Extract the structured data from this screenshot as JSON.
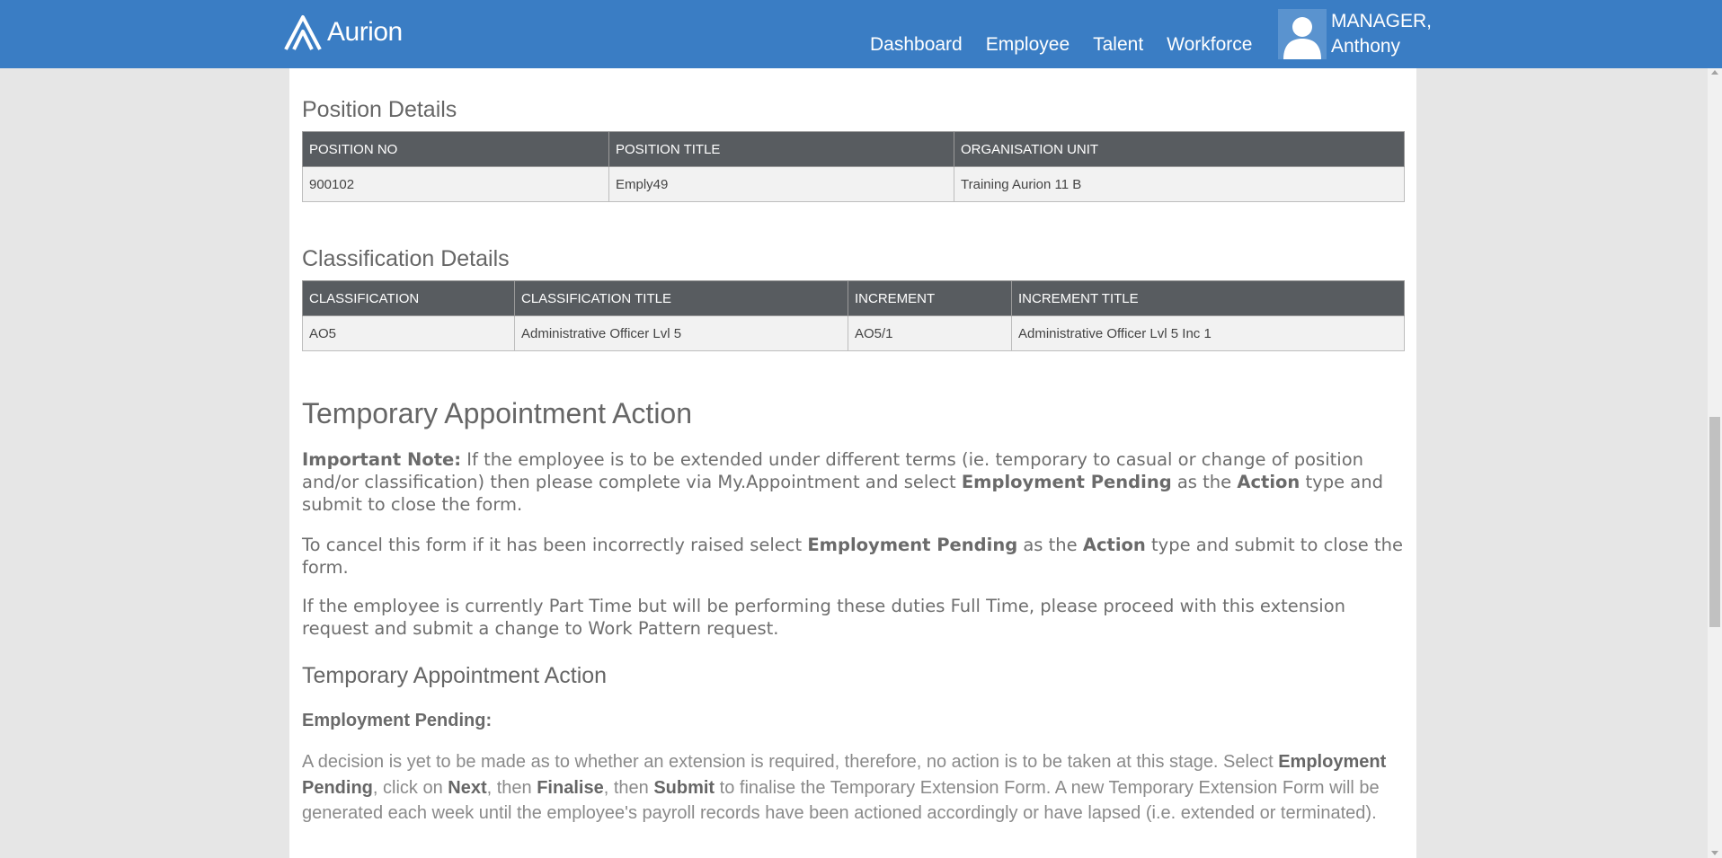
{
  "header": {
    "logo_text": "Aurion",
    "nav": [
      "Dashboard",
      "Employee",
      "Talent",
      "Workforce"
    ],
    "user_line1": "MANAGER,",
    "user_line2": "Anthony"
  },
  "position": {
    "title": "Position Details",
    "columns": [
      "POSITION NO",
      "POSITION TITLE",
      "ORGANISATION UNIT"
    ],
    "row": [
      "900102",
      "Emply49",
      "Training Aurion 11 B"
    ]
  },
  "classification": {
    "title": "Classification Details",
    "columns": [
      "CLASSIFICATION",
      "CLASSIFICATION TITLE",
      "INCREMENT",
      "INCREMENT TITLE"
    ],
    "row": [
      "AO5",
      "Administrative Officer Lvl 5",
      "AO5/1",
      "Administrative Officer Lvl 5 Inc 1"
    ]
  },
  "action": {
    "heading": "Temporary Appointment Action",
    "note1_label": "Important Note:",
    "note1_a": " If the employee is to be extended under different terms (ie. temporary to casual or change of position and/or classification) then please complete via My.Appointment and select ",
    "note1_b": "Employment Pending",
    "note1_c": " as the ",
    "note1_d": "Action",
    "note1_e": " type and submit to close the form.",
    "note2_a": "To cancel this form if it has been incorrectly raised select ",
    "note2_b": "Employment Pending",
    "note2_c": " as the ",
    "note2_d": "Action",
    "note2_e": " type and submit to close the form.",
    "note3": "If the employee is currently Part Time but will be performing these duties Full Time, please proceed with this extension request and submit a change to Work Pattern request.",
    "subheading": "Temporary Appointment Action",
    "pending_label": "Employment Pending:",
    "pending_a": "A decision is yet to be made as to whether an extension is required, therefore, no action is to be taken at this stage. Select ",
    "pending_b": "Employment Pending",
    "pending_c": ", click on ",
    "pending_d": "Next",
    "pending_e": ", then ",
    "pending_f": "Finalise",
    "pending_g": ", then ",
    "pending_h": "Submit",
    "pending_i": " to finalise the Temporary Extension Form. A new Temporary Extension Form will be generated each week until the employee's payroll records have been actioned accordingly or have lapsed (i.e. extended or terminated)."
  }
}
